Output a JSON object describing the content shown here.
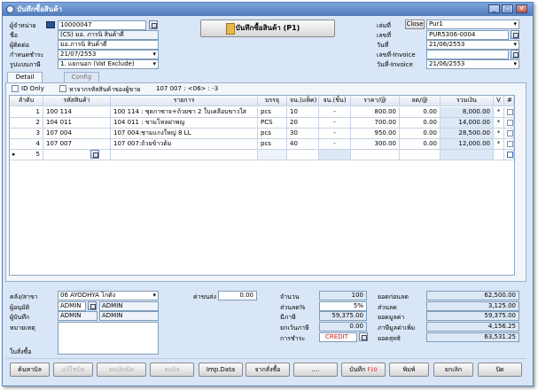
{
  "window": {
    "title": "บันทึกซื้อสินค้า"
  },
  "header": {
    "supplier_label": "ผู้จำหน่าย",
    "supplier_code": "10000047",
    "name_label": "ชื่อ",
    "name_value": "(CS) มอ. ภารนิ สินค้าดี",
    "contact_label": "ผู้ติดต่อ",
    "contact_value": "มอ.ภารนิ สินค้าดี",
    "due_label": "กำหนดชำระ",
    "due_value": "21/07/2553",
    "tax_label": "รูปแบบภาษี",
    "tax_value": "1. แยกนอก (Vat Exclude)",
    "main_button": "บันทึกซื้อสินค้า (P1)",
    "book_label": "เล่มที่",
    "close_button": "Close",
    "book_value": "Pur1",
    "doc_label": "เลขที่",
    "doc_value": "PUR5306-0004",
    "date_label": "วันที่",
    "date_value": "21/06/2553",
    "invoice_label": "เลขที่-Invoice",
    "invoice_value": "",
    "invoice_date_label": "วันที่-Invoice",
    "invoice_date_value": "21/06/2553"
  },
  "tabs": [
    {
      "label": "Detail"
    },
    {
      "label": "Config"
    }
  ],
  "options": {
    "id_only": "ID Only",
    "search_supplier": "หาจากรหัสสินค้าของผู้ขาย",
    "info": "107 007 :  <06> : -3"
  },
  "grid": {
    "columns": [
      "ลำดับ",
      "รหัสสินค้า",
      "รายการ",
      "บรรจุ",
      "จน.(แพ็ค)",
      "จน.(ชิ้น)",
      "ราคา/@",
      "ลด/@",
      "รวมเงิน",
      "V",
      "#"
    ],
    "rows": [
      {
        "no": "1",
        "code": "100 114",
        "desc": "100 114 : ชุดกาซาจ+ถ้วยชา 2 ใบเคลือบขาวใส",
        "unit": "pcs",
        "pack": "10",
        "piece": "-",
        "price": "800.00",
        "disc": "0.00",
        "total": "8,000.00",
        "v": "*"
      },
      {
        "no": "2",
        "code": "104 011",
        "desc": "104 011 : ชามโหลฝาพญ",
        "unit": "PCS",
        "pack": "20",
        "piece": "-",
        "price": "700.00",
        "disc": "0.00",
        "total": "14,000.00",
        "v": "*"
      },
      {
        "no": "3",
        "code": "107 004",
        "desc": "107 004:ชามแกงใหญ่  8   LL",
        "unit": "pcs",
        "pack": "30",
        "piece": "-",
        "price": "950.00",
        "disc": "0.00",
        "total": "28,500.00",
        "v": "*"
      },
      {
        "no": "4",
        "code": "107 007",
        "desc": "107 007:ถ้วยข้าวต้ม",
        "unit": "pcs",
        "pack": "40",
        "piece": "-",
        "price": "300.00",
        "disc": "0.00",
        "total": "12,000.00",
        "v": "*"
      },
      {
        "no": "5",
        "code": "",
        "desc": "",
        "unit": "",
        "pack": "",
        "piece": "",
        "price": "",
        "disc": "",
        "total": "",
        "v": ""
      }
    ]
  },
  "footer": {
    "warehouse_label": "คลัง/สาขา",
    "warehouse_value": "06  AYODHYA โกดัง",
    "shipping_label": "ค่าขนส่ง",
    "shipping_value": "0.00",
    "approver_label": "ผู้อนุมัติ",
    "approver_code": "ADMIN",
    "approver_name": "ADMIN",
    "recorder_label": "ผู้บันทึก",
    "recorder_code": "ADMIN",
    "recorder_name": "ADMIN",
    "note_label": "หมายเหตุ",
    "receipt_label": "ใบสั่งซื้อ",
    "qty_label": "จำนวน",
    "qty_value": "100",
    "disc_pct_label": "ส่วนลด%",
    "disc_pct_value": "5%",
    "vat_label": "มีภาษี",
    "vat_value": "59,375.00",
    "nonvat_label": "ยกเว้นภาษี",
    "nonvat_value": "0.00",
    "payment_label": "การชำระ",
    "payment_value": "CREDIT",
    "gross_label": "ยอดก่อนลด",
    "gross_value": "62,500.00",
    "discount_label": "ส่วนลด",
    "discount_value": "3,125.00",
    "subtotal_label": "ยอดมูลค่า",
    "subtotal_value": "59,375.00",
    "tax_amount_label": "ภาษีมูลค่าเพิ่ม",
    "tax_amount_value": "4,156.25",
    "net_label": "ยอดสุทธิ",
    "net_value": "63,531.25"
  },
  "buttons": {
    "search": "ค้นหาบิล",
    "edit": "แก้ไขบิล",
    "cancel_bill": "ยกเลิกบิล",
    "delete": "ลบบิล",
    "import": "Imp.Data",
    "from_order": "จากสั่งซื้อ",
    "more": "....",
    "save": "บันทึก",
    "save_key": "F10",
    "print": "พิมพ์",
    "cancel": "ยกเลิก",
    "close": "ปิด"
  }
}
